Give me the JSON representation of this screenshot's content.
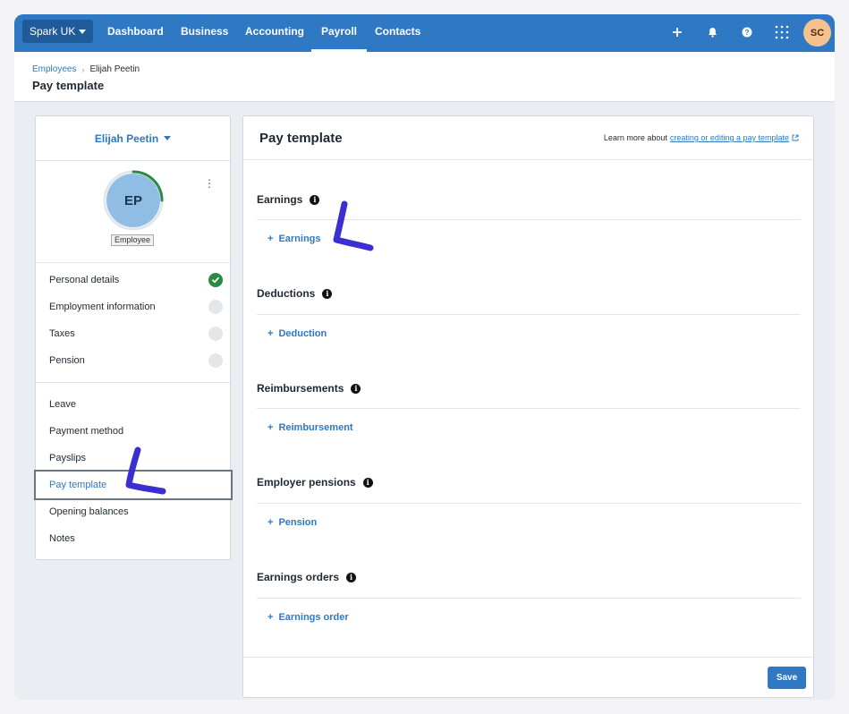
{
  "nav": {
    "org": "Spark UK",
    "items": [
      "Dashboard",
      "Business",
      "Accounting",
      "Payroll",
      "Contacts"
    ],
    "active": "Payroll",
    "user_initials": "SC",
    "icons": [
      "plus-icon",
      "bell-icon",
      "help-icon",
      "app-grid-icon"
    ]
  },
  "header": {
    "breadcrumb": {
      "parent": "Employees",
      "current": "Elijah Peetin"
    },
    "title": "Pay template"
  },
  "employee": {
    "name": "Elijah Peetin",
    "initials": "EP",
    "role": "Employee",
    "setup_progress": 0.25
  },
  "sidebar": {
    "setup_items": [
      {
        "label": "Personal details",
        "status": "complete"
      },
      {
        "label": "Employment information",
        "status": "incomplete"
      },
      {
        "label": "Taxes",
        "status": "incomplete"
      },
      {
        "label": "Pension",
        "status": "incomplete"
      }
    ],
    "menu_items": [
      "Leave",
      "Payment method",
      "Payslips",
      "Pay template",
      "Opening balances",
      "Notes"
    ],
    "active": "Pay template"
  },
  "main": {
    "title": "Pay template",
    "learn_more_prefix": "Learn more about",
    "learn_more_link": "creating or editing a pay template",
    "sections": [
      {
        "title": "Earnings",
        "add_label": "Earnings"
      },
      {
        "title": "Deductions",
        "add_label": "Deduction"
      },
      {
        "title": "Reimbursements",
        "add_label": "Reimbursement"
      },
      {
        "title": "Employer pensions",
        "add_label": "Pension"
      },
      {
        "title": "Earnings orders",
        "add_label": "Earnings order"
      }
    ],
    "save_label": "Save"
  },
  "colors": {
    "brand": "#2f78c4",
    "complete": "#2a8a42",
    "annotation": "#3b2fd1"
  }
}
